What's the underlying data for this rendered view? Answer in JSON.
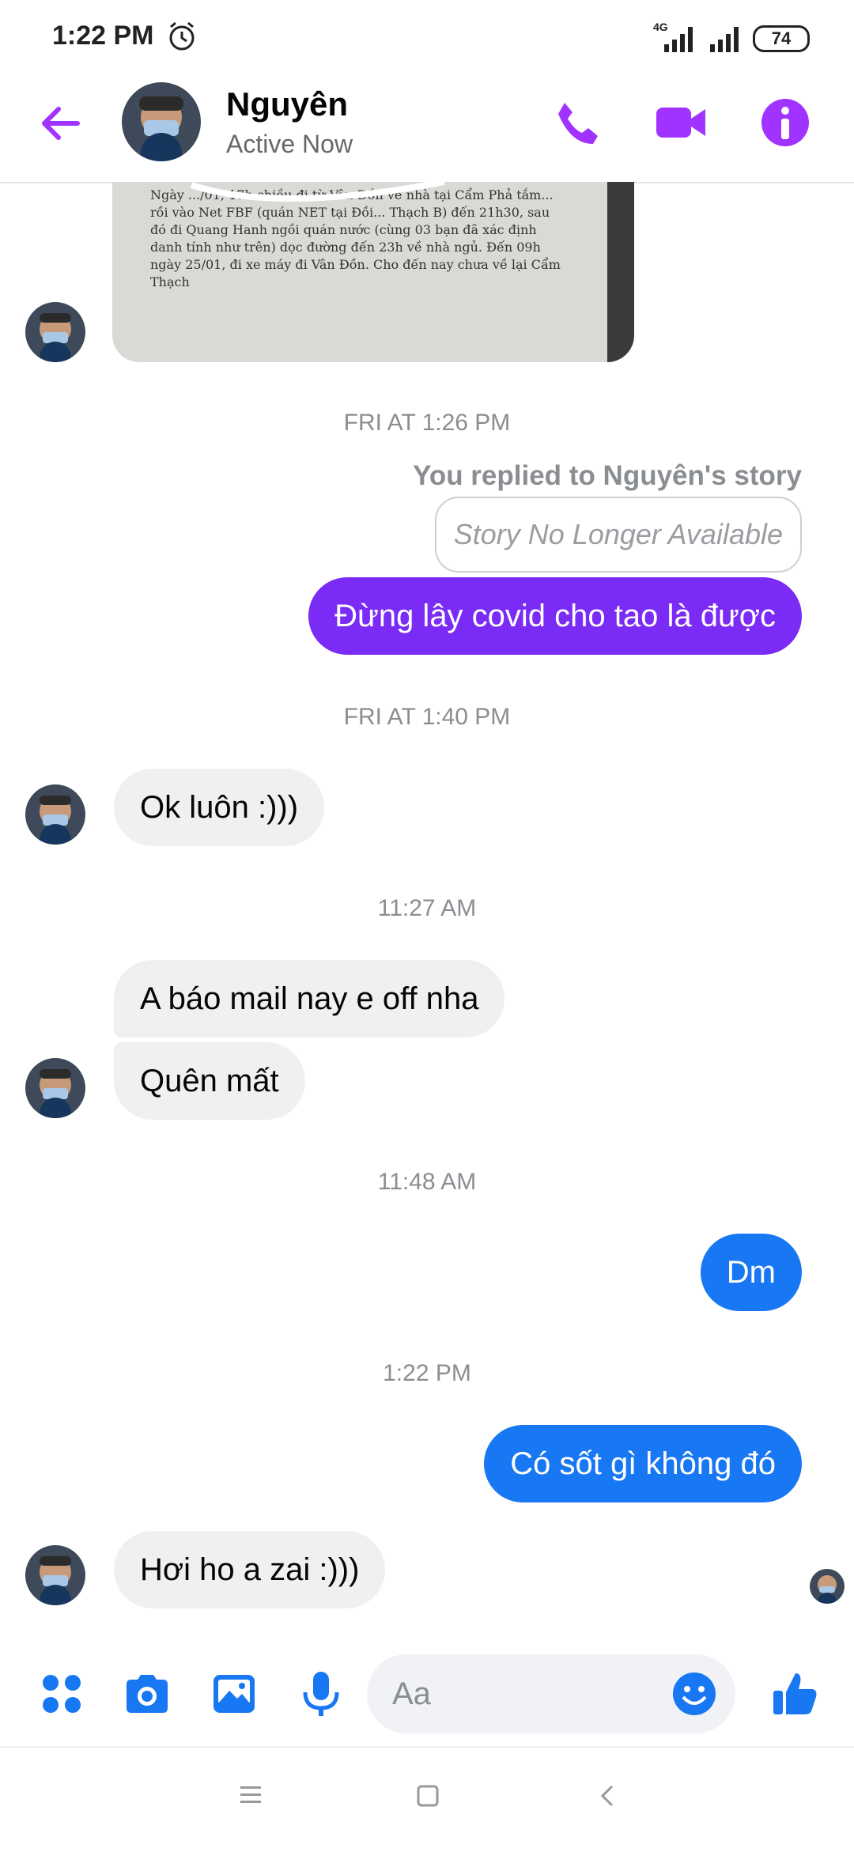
{
  "status": {
    "time": "1:22 PM",
    "network": "4G",
    "battery": "74"
  },
  "header": {
    "name": "Nguyên",
    "status": "Active Now"
  },
  "photo_text": "Ngày .../01, 17h chiều đi từ Vân Đồn về nhà tại Cẩm Phả tắm... rồi vào Net FBF (quán NET tại Đồi... Thạch B) đến 21h30, sau đó đi Quang Hanh ngồi quán nước (cùng 03 bạn đã xác định danh tính như trên) dọc đường đến 23h về nhà ngủ. Đến 09h ngày 25/01, đi xe máy đi Vân Đồn. Cho đến nay chưa về lại Cẩm Thạch",
  "messages": {
    "ts1": "FRI AT 1:26 PM",
    "reply_note": "You replied to Nguyên's story",
    "story_unavailable": "Story No Longer Available",
    "m1": "Đừng lây covid cho tao là được",
    "ts2": "FRI AT 1:40 PM",
    "m2": "Ok luôn :)))",
    "ts3": "11:27 AM",
    "m3": "A báo mail nay e off nha",
    "m4": "Quên mất",
    "ts4": "11:48 AM",
    "m5": "Dm",
    "ts5": "1:22 PM",
    "m6": "Có sốt gì không đó",
    "m7": "Hơi ho a zai :)))"
  },
  "composer": {
    "placeholder": "Aa"
  },
  "colors": {
    "accent": "#a033ff",
    "outgoing_purple": "#7a2bf5",
    "outgoing_blue": "#1877f2",
    "incoming": "#f0f0f0"
  }
}
